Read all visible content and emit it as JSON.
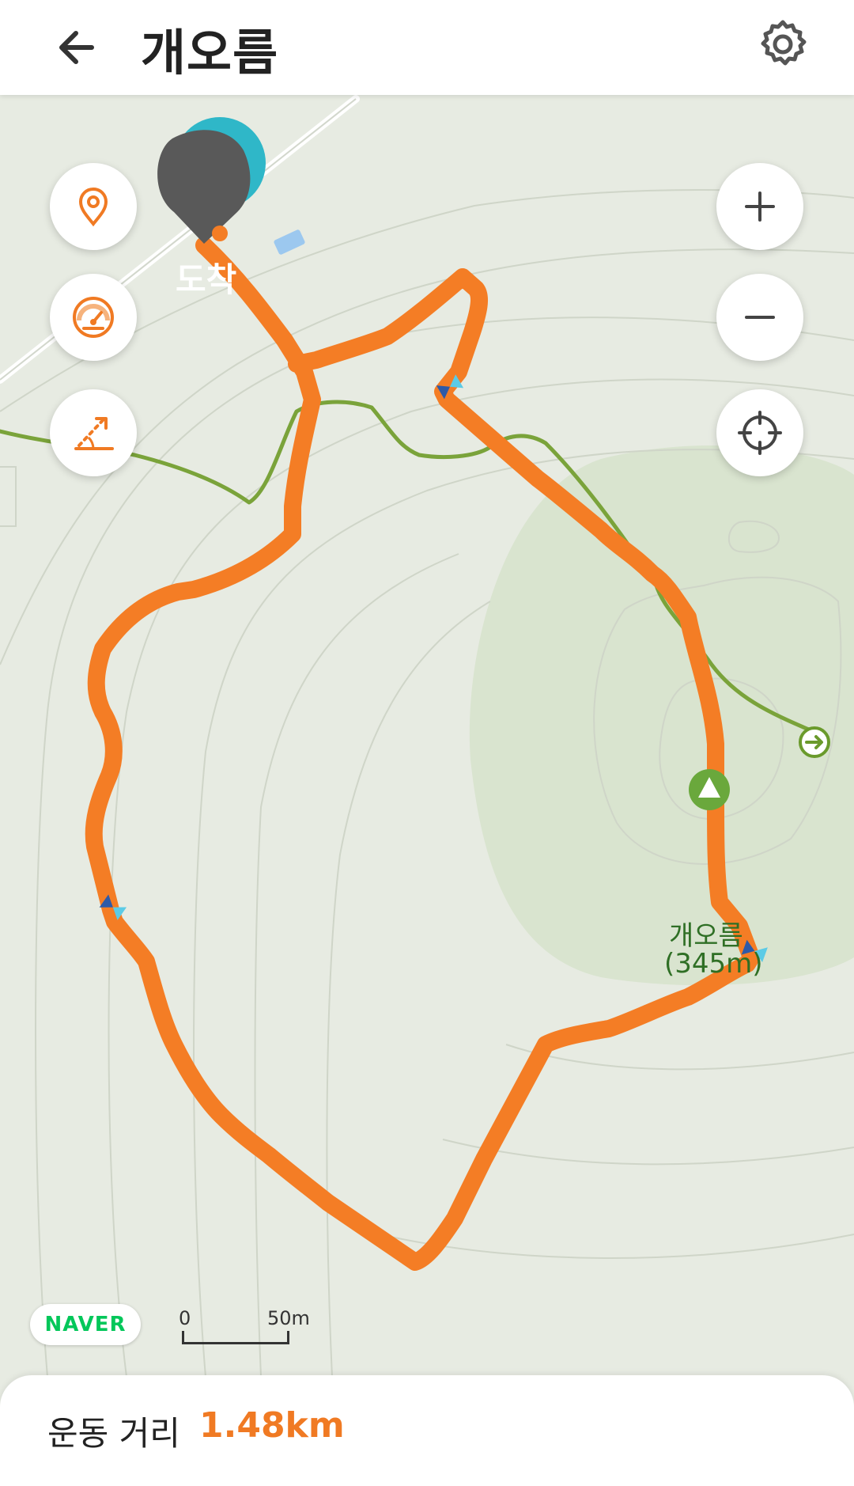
{
  "header": {
    "title": "개오름",
    "back_icon": "arrow-left-icon",
    "settings_icon": "gear-icon"
  },
  "map": {
    "arrival_marker_label": "도착",
    "peak": {
      "name": "개오름",
      "elevation": "(345m)"
    },
    "brand": "NAVER",
    "scale": {
      "zero": "0",
      "max": "50m"
    },
    "controls_left": [
      "location-pin-icon",
      "speedometer-icon",
      "route-slope-icon"
    ],
    "controls_right": [
      "zoom-in-icon",
      "zoom-out-icon",
      "crosshair-icon"
    ]
  },
  "stats": {
    "distance_label": "운동 거리",
    "distance_value": "1.48km"
  },
  "colors": {
    "route": "#f47d25",
    "trail": "#7aa33a",
    "map_bg": "#e7ebe2",
    "peak_area": "#d9e4cf"
  }
}
